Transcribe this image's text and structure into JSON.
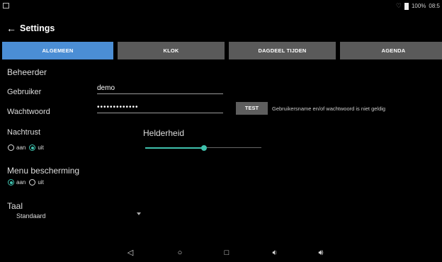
{
  "status_bar": {
    "battery": "100%",
    "time": "08:5"
  },
  "app_bar": {
    "title": "Settings",
    "back_icon": "arrow-left-icon"
  },
  "tabs": [
    {
      "label": "ALGEMEEN",
      "active": true
    },
    {
      "label": "KLOK",
      "active": false
    },
    {
      "label": "DAGDEEL TIJDEN",
      "active": false
    },
    {
      "label": "AGENDA",
      "active": false
    }
  ],
  "admin": {
    "section_title": "Beheerder",
    "user_label": "Gebruiker",
    "user_value": "demo",
    "password_label": "Wachtwoord",
    "password_value": "•••••••••••••",
    "test_button": "TEST",
    "test_message": "Gebruikersname en/of wachtwoord is niet geldig"
  },
  "night_rest": {
    "title": "Nachtrust",
    "options": [
      {
        "label": "aan",
        "checked": false
      },
      {
        "label": "uit",
        "checked": true
      }
    ]
  },
  "brightness": {
    "title": "Helderheid",
    "level_fraction": 0.5
  },
  "menu_protection": {
    "title": "Menu bescherming",
    "options": [
      {
        "label": "aan",
        "checked": true
      },
      {
        "label": "uit",
        "checked": false
      }
    ]
  },
  "language": {
    "title": "Taal",
    "selected": "Standaard"
  },
  "colors": {
    "accent": "#3fc1ad",
    "tab_active": "#4b8ed5",
    "tab_inactive": "#5a5a5a"
  }
}
